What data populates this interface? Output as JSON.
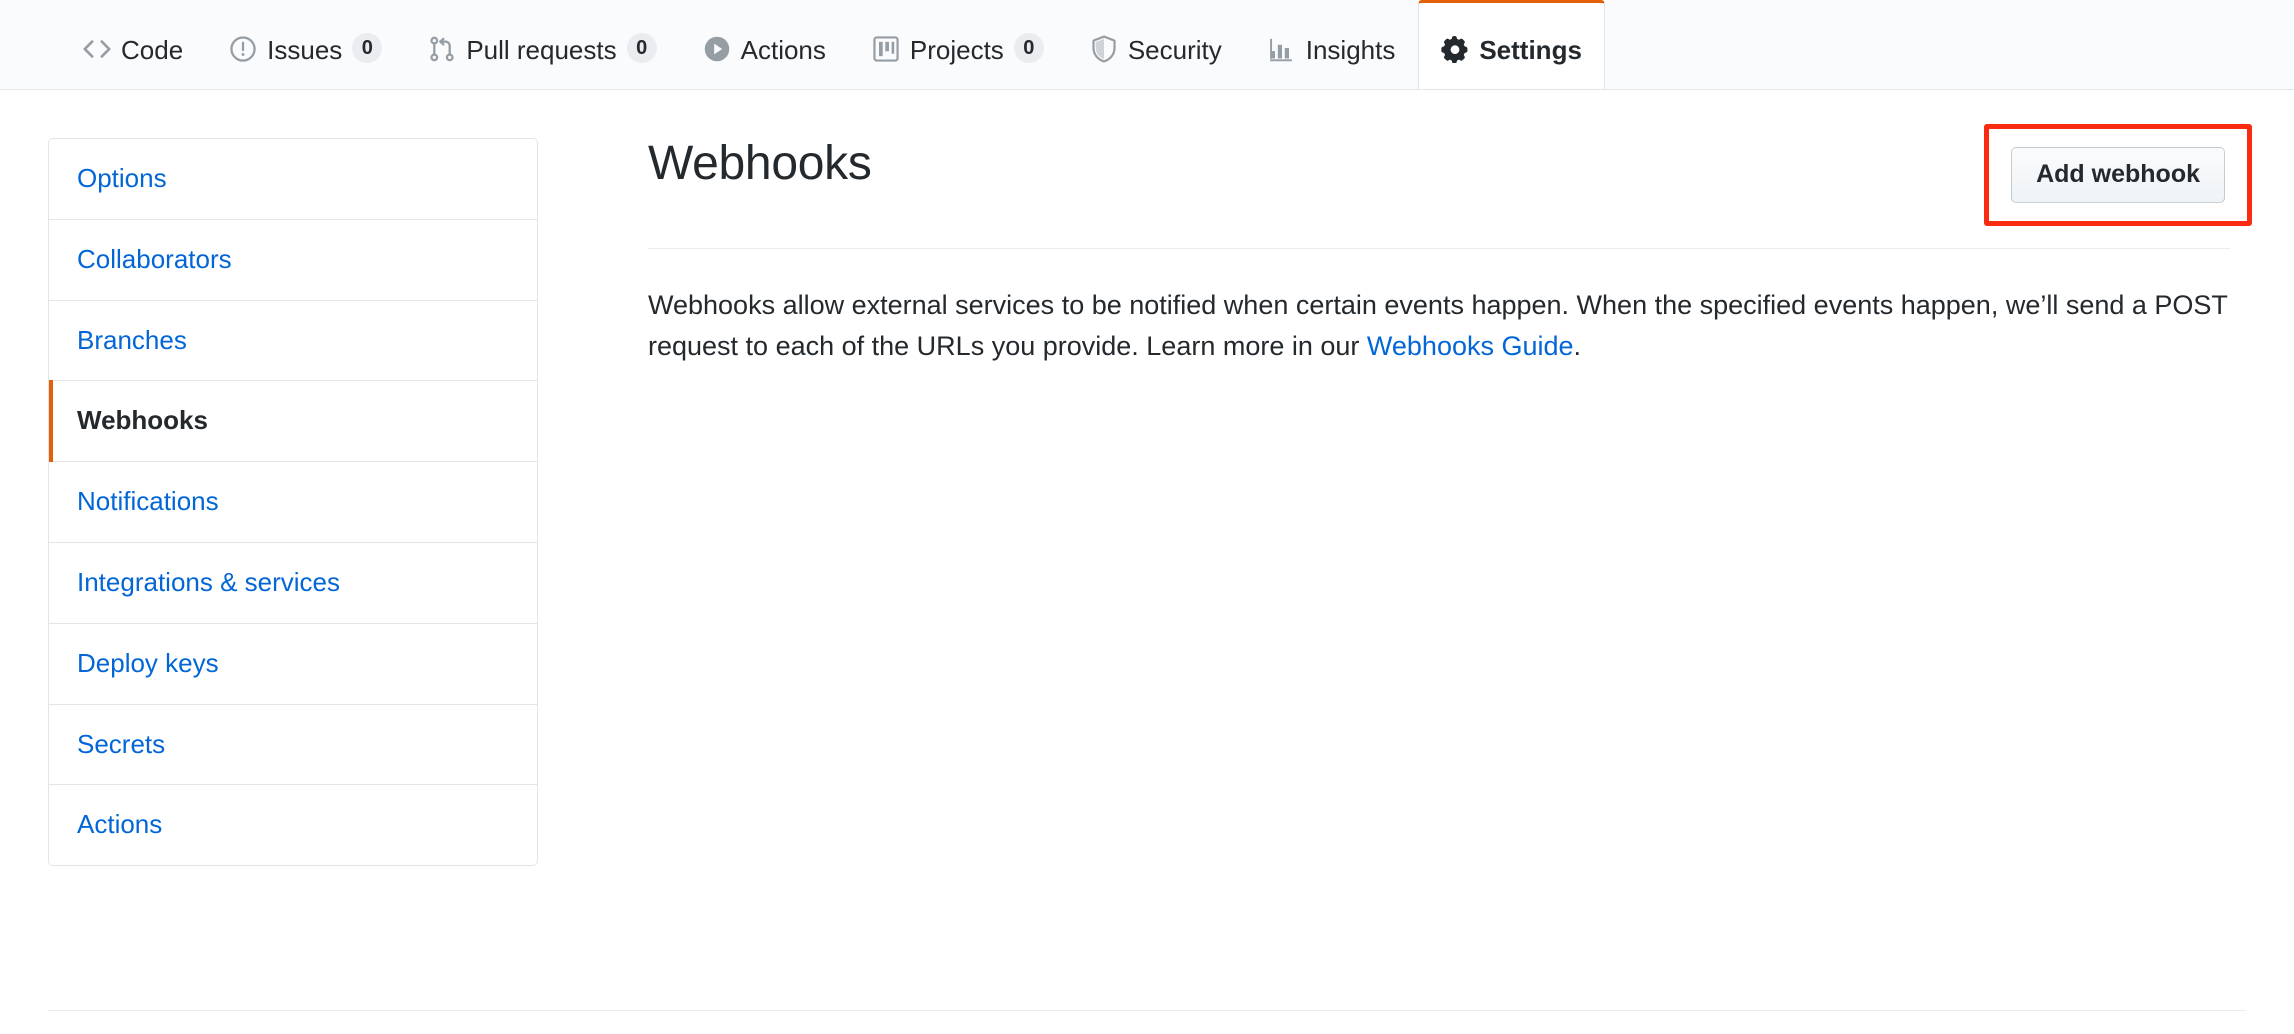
{
  "repo_nav": {
    "tabs": [
      {
        "label": "Code",
        "icon": "code-icon",
        "count": null,
        "selected": false
      },
      {
        "label": "Issues",
        "icon": "issue-opened-icon",
        "count": "0",
        "selected": false
      },
      {
        "label": "Pull requests",
        "icon": "git-pull-request-icon",
        "count": "0",
        "selected": false
      },
      {
        "label": "Actions",
        "icon": "play-icon",
        "count": null,
        "selected": false
      },
      {
        "label": "Projects",
        "icon": "project-board-icon",
        "count": "0",
        "selected": false
      },
      {
        "label": "Security",
        "icon": "shield-icon",
        "count": null,
        "selected": false
      },
      {
        "label": "Insights",
        "icon": "graph-icon",
        "count": null,
        "selected": false
      },
      {
        "label": "Settings",
        "icon": "gear-icon",
        "count": null,
        "selected": true
      }
    ]
  },
  "sidebar": {
    "items": [
      {
        "label": "Options",
        "selected": false
      },
      {
        "label": "Collaborators",
        "selected": false
      },
      {
        "label": "Branches",
        "selected": false
      },
      {
        "label": "Webhooks",
        "selected": true
      },
      {
        "label": "Notifications",
        "selected": false
      },
      {
        "label": "Integrations & services",
        "selected": false
      },
      {
        "label": "Deploy keys",
        "selected": false
      },
      {
        "label": "Secrets",
        "selected": false
      },
      {
        "label": "Actions",
        "selected": false
      }
    ]
  },
  "main": {
    "title": "Webhooks",
    "add_button_label": "Add webhook",
    "description_part1": "Webhooks allow external services to be notified when certain events happen. When the specified events happen, we’ll send a POST request to each of the URLs you provide. Learn more in our ",
    "description_link": "Webhooks Guide",
    "description_part2": "."
  },
  "colors": {
    "accent_orange": "#e36209",
    "link_blue": "#0366d6",
    "highlight_red": "#fa2b11",
    "text_dark": "#24292e",
    "border_gray": "#e1e4e8",
    "nav_background": "#fafbfc"
  }
}
